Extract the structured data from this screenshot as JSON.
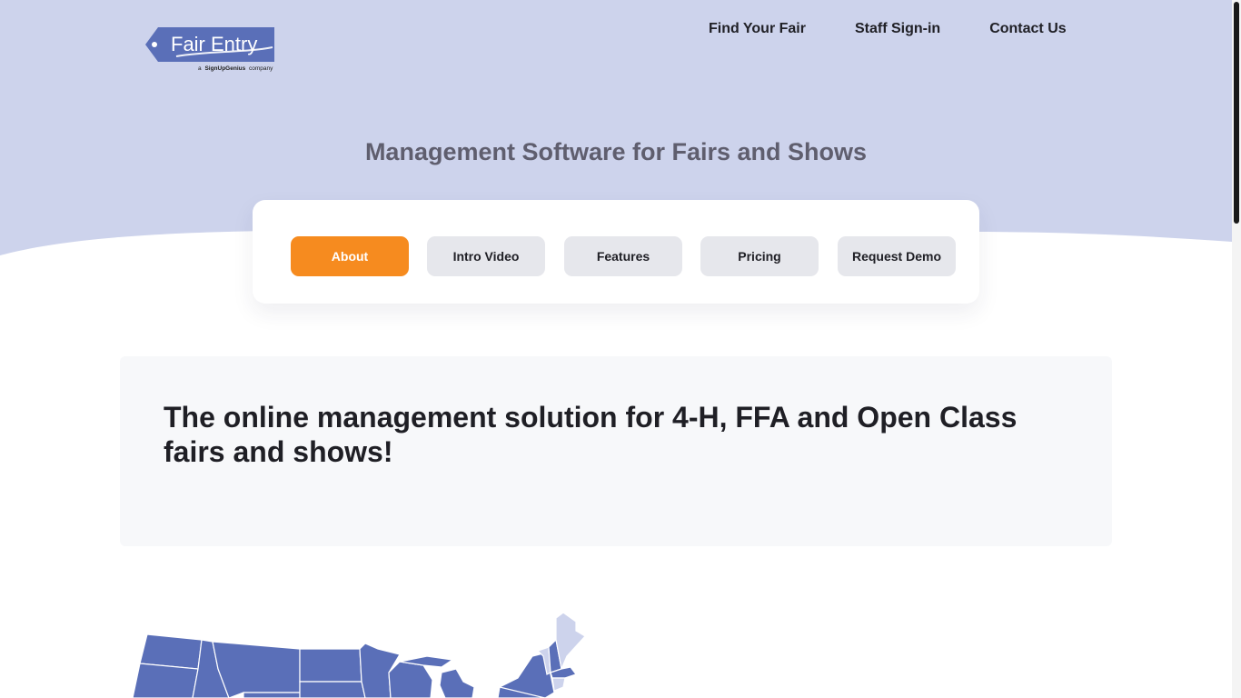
{
  "brand": {
    "logo_text": "Fair Entry",
    "tagline_prefix": "a",
    "tagline_brand": "SignUpGenius",
    "tagline_suffix": "company"
  },
  "nav": {
    "items": [
      {
        "label": "Find Your Fair"
      },
      {
        "label": "Staff Sign-in"
      },
      {
        "label": "Contact Us"
      }
    ]
  },
  "hero": {
    "title": "Management Software for Fairs and Shows"
  },
  "tabs": {
    "items": [
      {
        "label": "About",
        "active": true
      },
      {
        "label": "Intro Video",
        "active": false
      },
      {
        "label": "Features",
        "active": false
      },
      {
        "label": "Pricing",
        "active": false
      },
      {
        "label": "Request Demo",
        "active": false
      }
    ]
  },
  "about": {
    "heading": "The online management solution for 4-H, FFA and Open Class fairs and shows!"
  },
  "colors": {
    "hero_bg": "#cdd3ec",
    "brand_blue": "#5a6fb8",
    "accent_orange": "#f68b1f",
    "tab_inactive": "#e6e7ec"
  },
  "icons": {
    "logo": "fair-entry-ticket-logo",
    "map": "us-states-map"
  }
}
